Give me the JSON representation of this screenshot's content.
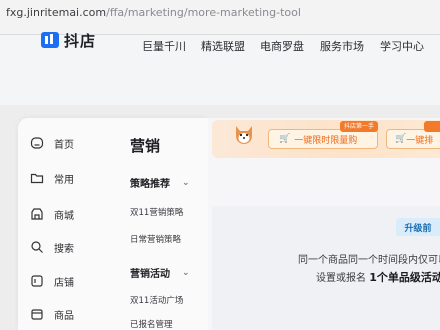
{
  "browser": {
    "url_host": "fxg.jinritemai.com",
    "url_path": "/ffa/marketing/more-marketing-tool"
  },
  "header": {
    "brand": "抖店",
    "nav": [
      "巨量千川",
      "精选联盟",
      "电商罗盘",
      "服务市场",
      "学习中心"
    ]
  },
  "sidebar": {
    "items": [
      {
        "label": "首页",
        "icon": "home-icon"
      },
      {
        "label": "常用",
        "icon": "folder-icon"
      },
      {
        "label": "商城",
        "icon": "shop-icon"
      },
      {
        "label": "搜索",
        "icon": "search-icon"
      },
      {
        "label": "店铺",
        "icon": "store-icon"
      },
      {
        "label": "商品",
        "icon": "product-icon"
      }
    ]
  },
  "submenu": {
    "title": "营销",
    "groups": [
      {
        "title": "策略推荐",
        "items": [
          "双11营销策略",
          "日常营销策略"
        ]
      },
      {
        "title": "营销活动",
        "items": [
          "双11活动广场",
          "已报名管理"
        ]
      }
    ]
  },
  "promo": {
    "button1": "一键限时限量购",
    "tag1": "抖店第一手",
    "button2": "一键排"
  },
  "card": {
    "badge": "升级前",
    "line1": "同一个商品同一个时间段内仅可以",
    "line2_prefix": "设置或报名",
    "line2_bold": "1个单品级活动"
  },
  "colors": {
    "accent_orange": "#ed6a1b",
    "badge_blue": "#1d6fb0",
    "brand_blue": "#1c6ef2"
  }
}
